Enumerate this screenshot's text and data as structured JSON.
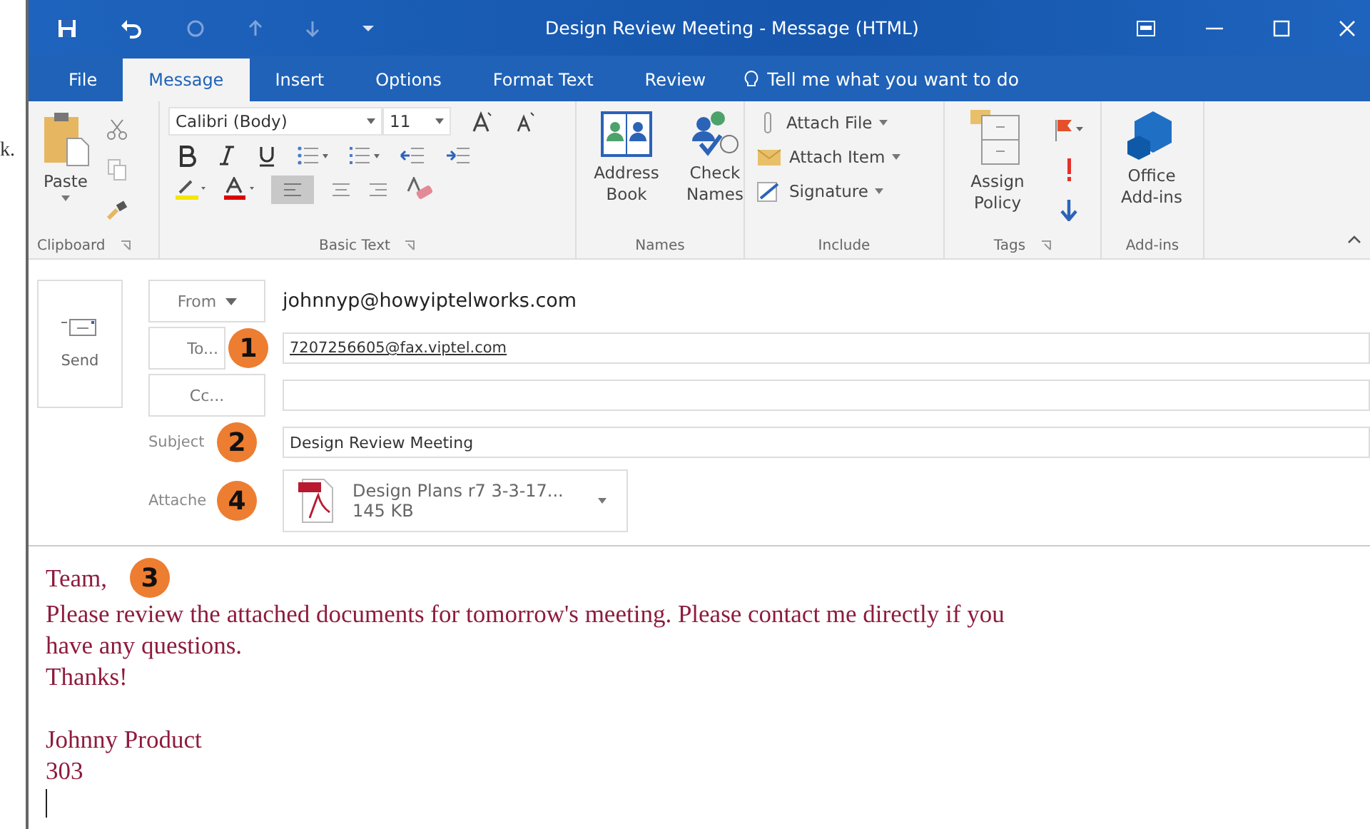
{
  "margin_text": "k.",
  "title_bar": {
    "title": "Design Review Meeting  -  Message (HTML)"
  },
  "tabs": [
    {
      "label": "File",
      "selected": false
    },
    {
      "label": "Message",
      "selected": true
    },
    {
      "label": "Insert",
      "selected": false
    },
    {
      "label": "Options",
      "selected": false
    },
    {
      "label": "Format Text",
      "selected": false
    },
    {
      "label": "Review",
      "selected": false
    }
  ],
  "tell_me": "Tell me what you want to do",
  "ribbon": {
    "clipboard": {
      "paste": "Paste",
      "label": "Clipboard"
    },
    "basic_text": {
      "font": "Calibri (Body)",
      "size": "11",
      "label": "Basic Text"
    },
    "names": {
      "buttons": [
        "Address Book",
        "Check Names"
      ],
      "label": "Names"
    },
    "include": {
      "items": [
        "Attach File",
        "Attach Item",
        "Signature"
      ],
      "label": "Include"
    },
    "tags": {
      "assign": "Assign Policy",
      "label": "Tags"
    },
    "addins": {
      "button": "Office Add-ins",
      "label": "Add-ins"
    }
  },
  "compose": {
    "send": "Send",
    "from_button": "From",
    "from_value": "johnnyp@howyiptelworks.com",
    "to_button": "To...",
    "to_value": "7207256605@fax.viptel.com",
    "cc_button": "Cc...",
    "subject_label": "Subject",
    "subject_value": "Design Review Meeting",
    "attached_label": "Attache",
    "attachment": {
      "name": "Design Plans r7 3-3-17...",
      "size": "145 KB"
    }
  },
  "body": [
    [
      "Team,"
    ],
    [
      "Please review the attached documents for tomorrow's meeting.  Please contact me directly if you",
      "have any questions."
    ],
    [
      "Thanks!"
    ],
    [
      "Johnny Product",
      "303"
    ]
  ],
  "badges": {
    "to": "1",
    "subject": "2",
    "attached": "4",
    "body": "3"
  }
}
